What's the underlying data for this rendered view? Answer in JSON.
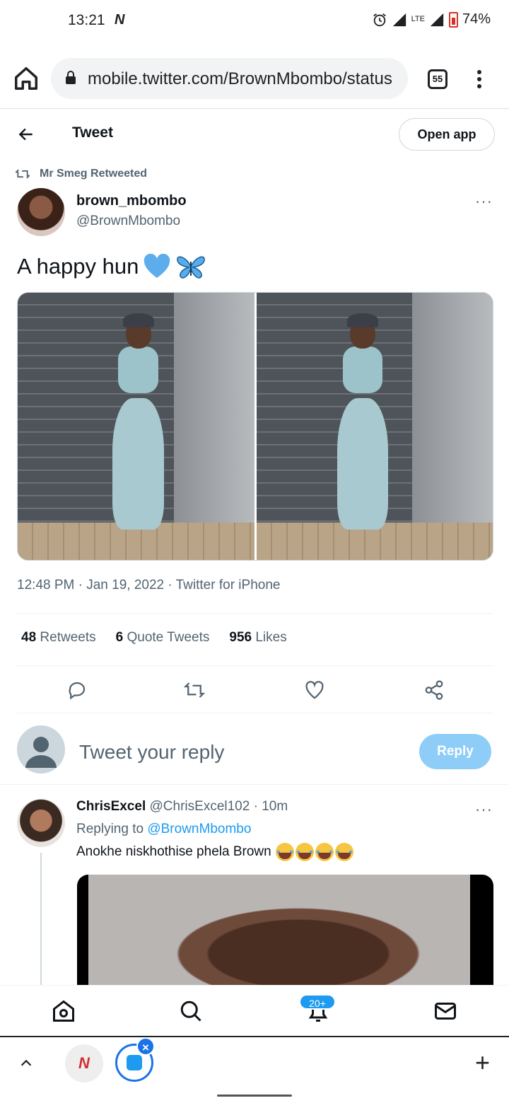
{
  "status_bar": {
    "time": "13:21",
    "notification_icon": "N",
    "lte_label": "LTE",
    "battery": "74%"
  },
  "browser": {
    "url": "mobile.twitter.com/BrownMbombo/status",
    "tab_count": "55"
  },
  "header": {
    "title": "Tweet",
    "open_app": "Open app"
  },
  "tweet": {
    "retweeted_by": "Mr Smeg Retweeted",
    "author_name": "brown_mbombo",
    "author_handle": "@BrownMbombo",
    "text": "A happy hun",
    "emojis": [
      "blue-heart-emoji",
      "butterfly-emoji"
    ],
    "timestamp": "12:48 PM · Jan 19, 2022 · Twitter for iPhone",
    "media_count": 2,
    "stats": {
      "retweets_count": "48",
      "retweets_label": "Retweets",
      "quotes_count": "6",
      "quotes_label": "Quote Tweets",
      "likes_count": "956",
      "likes_label": "Likes"
    },
    "more": "···"
  },
  "reply_composer": {
    "placeholder": "Tweet your reply",
    "button": "Reply"
  },
  "replies": [
    {
      "name": "ChrisExcel",
      "handle": "@ChrisExcel102",
      "time": "10m",
      "replying_prefix": "Replying to",
      "replying_to": "@BrownMbombo",
      "text": "Anokhe niskhothise phela Brown",
      "emoji_count": 4,
      "more": "···"
    }
  ],
  "bottom_nav": {
    "notifications_badge": "20+"
  },
  "chrome_bottom": {
    "tab_letter": "N",
    "close_label": "×",
    "plus_label": "+"
  },
  "colors": {
    "accent": "#1d9bf0",
    "reply_button": "#8ecdf8",
    "text_secondary": "#536471"
  }
}
